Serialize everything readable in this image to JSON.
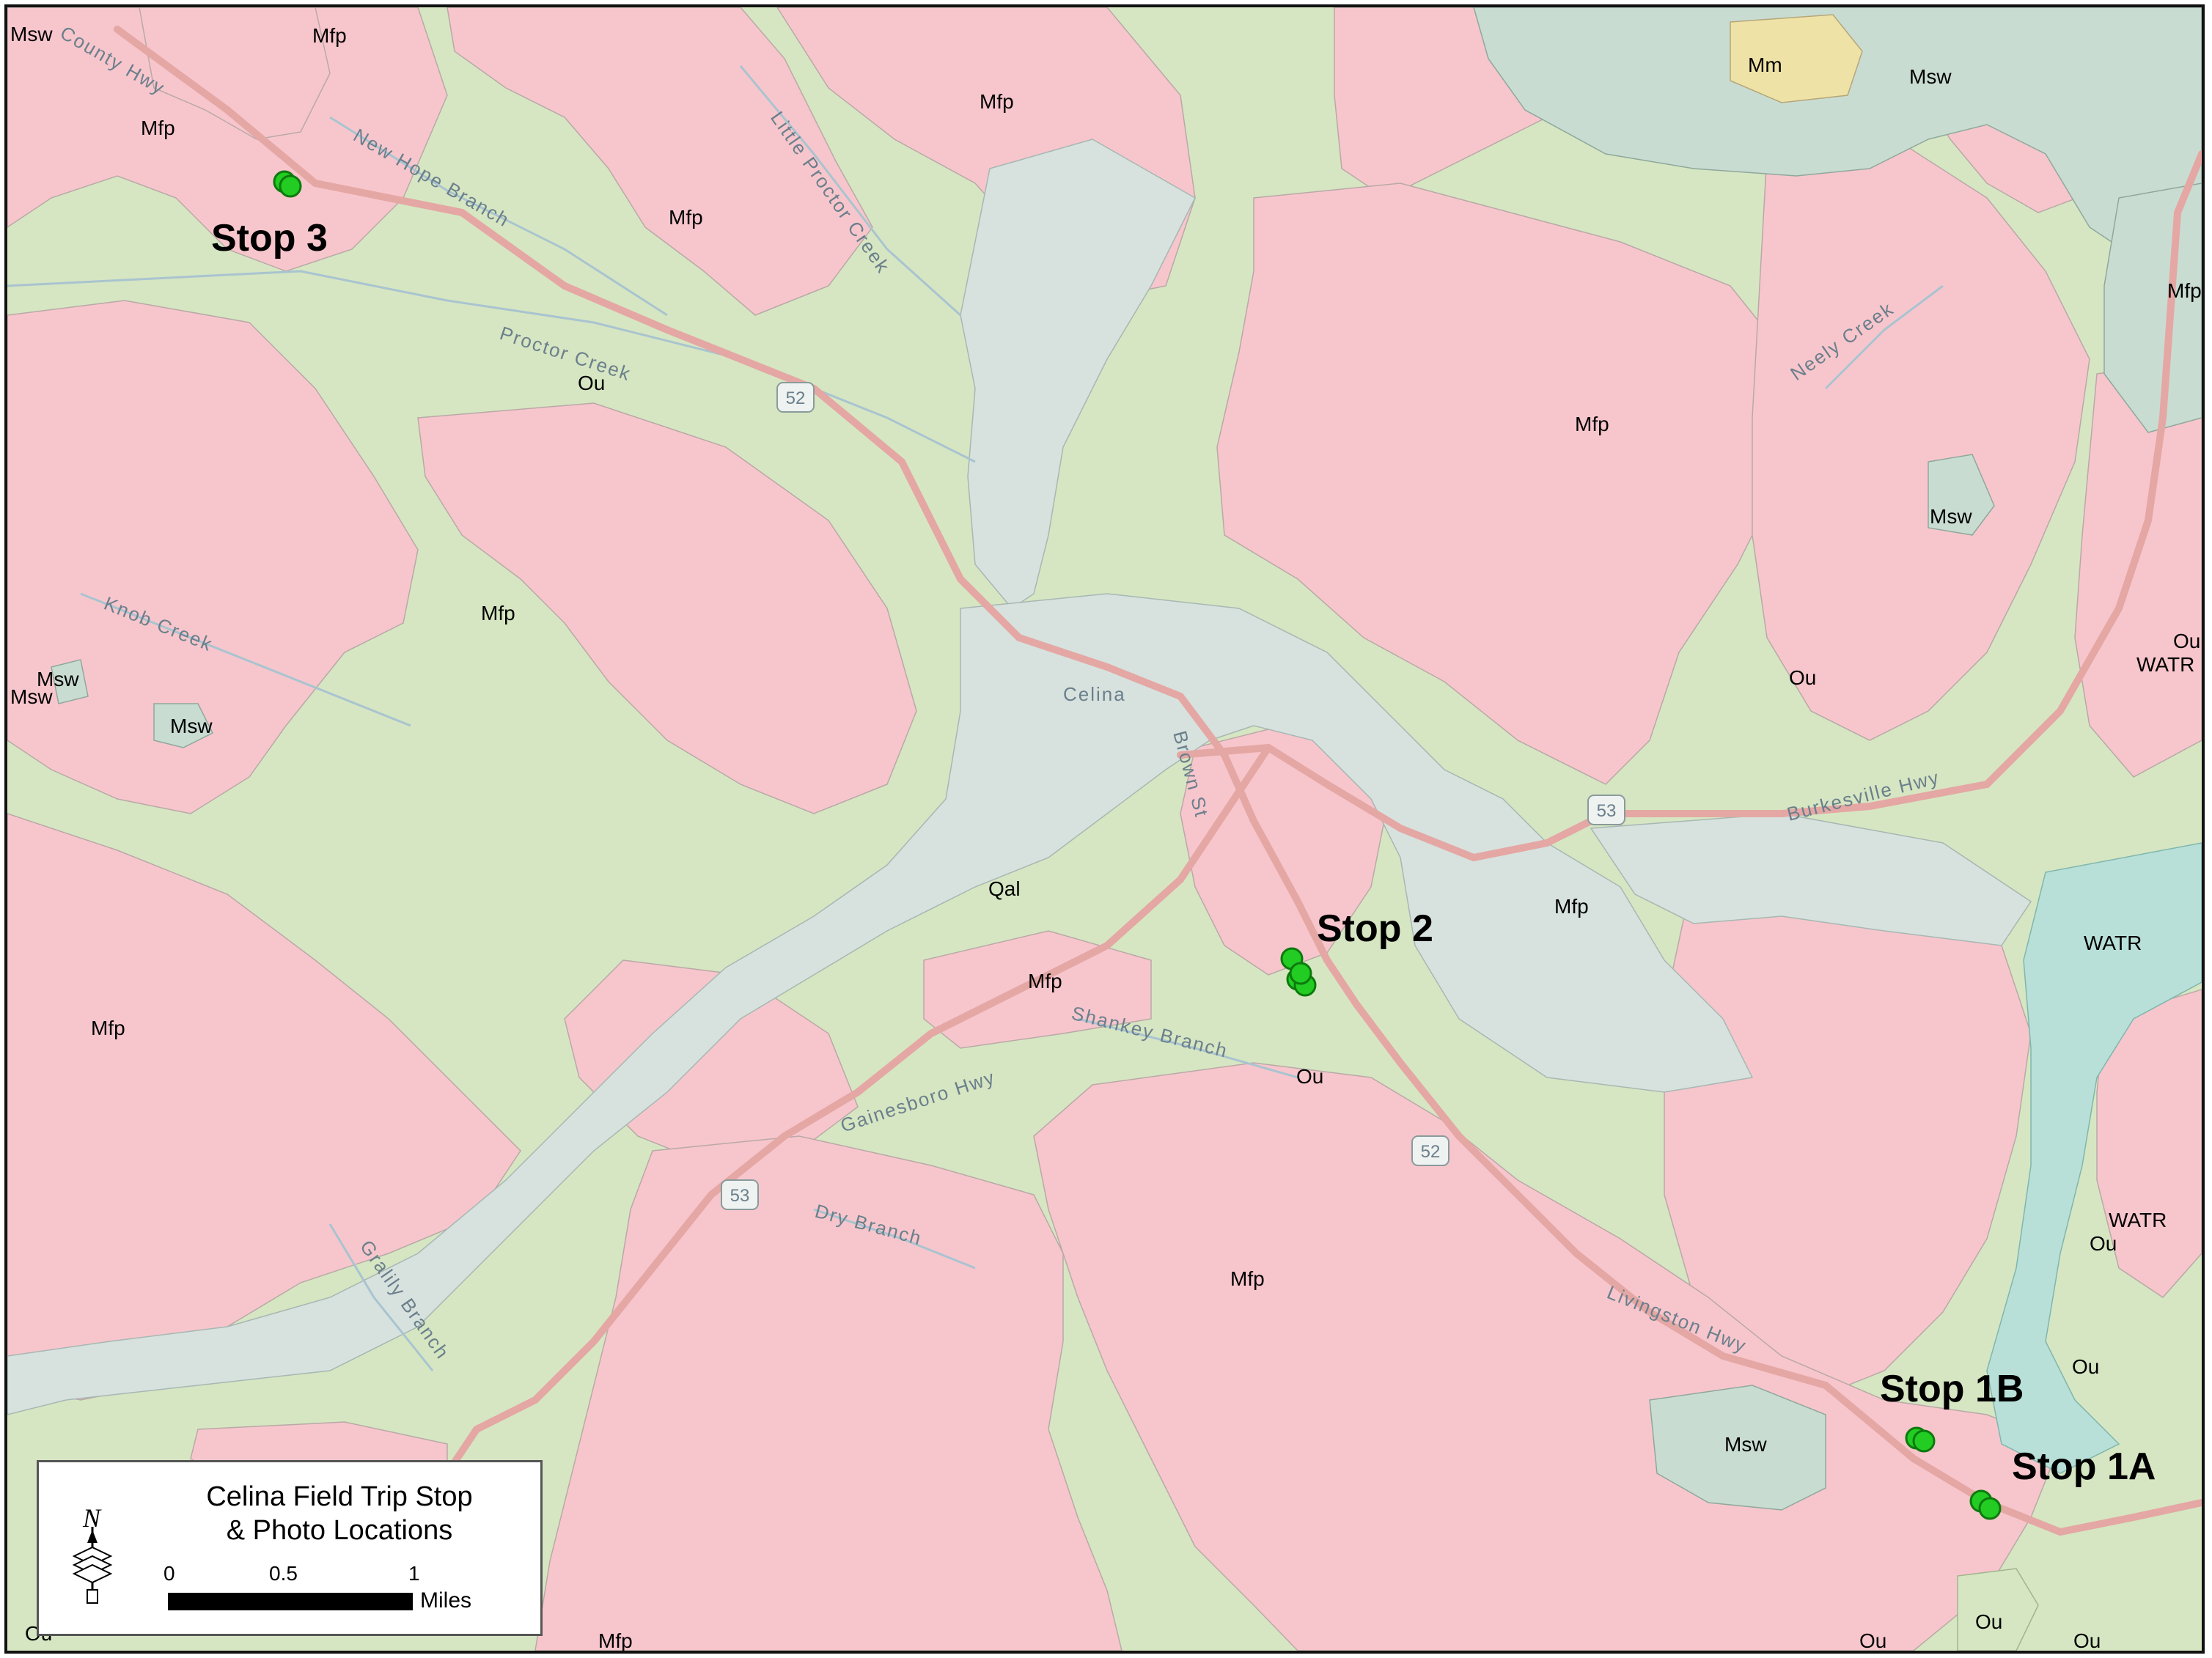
{
  "legend": {
    "title_line1": "Celina Field Trip Stop",
    "title_line2": "& Photo Locations",
    "north": "N",
    "scale_ticks": [
      "0",
      "0.5",
      "1"
    ],
    "scale_unit": "Miles"
  },
  "stops": [
    {
      "id": "stop-3",
      "label": "Stop 3"
    },
    {
      "id": "stop-2",
      "label": "Stop 2"
    },
    {
      "id": "stop-1b",
      "label": "Stop 1B"
    },
    {
      "id": "stop-1a",
      "label": "Stop 1A"
    }
  ],
  "places": {
    "town": "Celina",
    "streets": {
      "county_hwy": "County Hwy",
      "brown_st": "Brown St",
      "burkesville_hwy": "Burkesville Hwy",
      "gainesboro_hwy": "Gainesboro Hwy",
      "livingston_hwy": "Livingston Hwy"
    },
    "streams": {
      "new_hope_branch": "New Hope Branch",
      "little_proctor_creek": "Little Proctor Creek",
      "proctor_creek": "Proctor Creek",
      "neely_creek": "Neely Creek",
      "knob_creek": "Knob Creek",
      "shankey_branch": "Shankey Branch",
      "dry_branch": "Dry Branch",
      "gralily_branch": "Gralily Branch"
    },
    "route_shields": [
      "52",
      "53"
    ]
  },
  "geologic_units": {
    "Mfp": "Mfp",
    "Msw": "Msw",
    "Ou": "Ou",
    "Qal": "Qal",
    "Mm": "Mm",
    "WATR": "WATR"
  },
  "colors": {
    "mfp": "#f7c6cc",
    "ou": "#d6e6c2",
    "qal": "#d7e2de",
    "msw": "#c9dcd2",
    "mm": "#efe2a6",
    "watr": "#b8e0d8",
    "stop_marker": "#22cc22",
    "road": "#e4a7a4"
  }
}
